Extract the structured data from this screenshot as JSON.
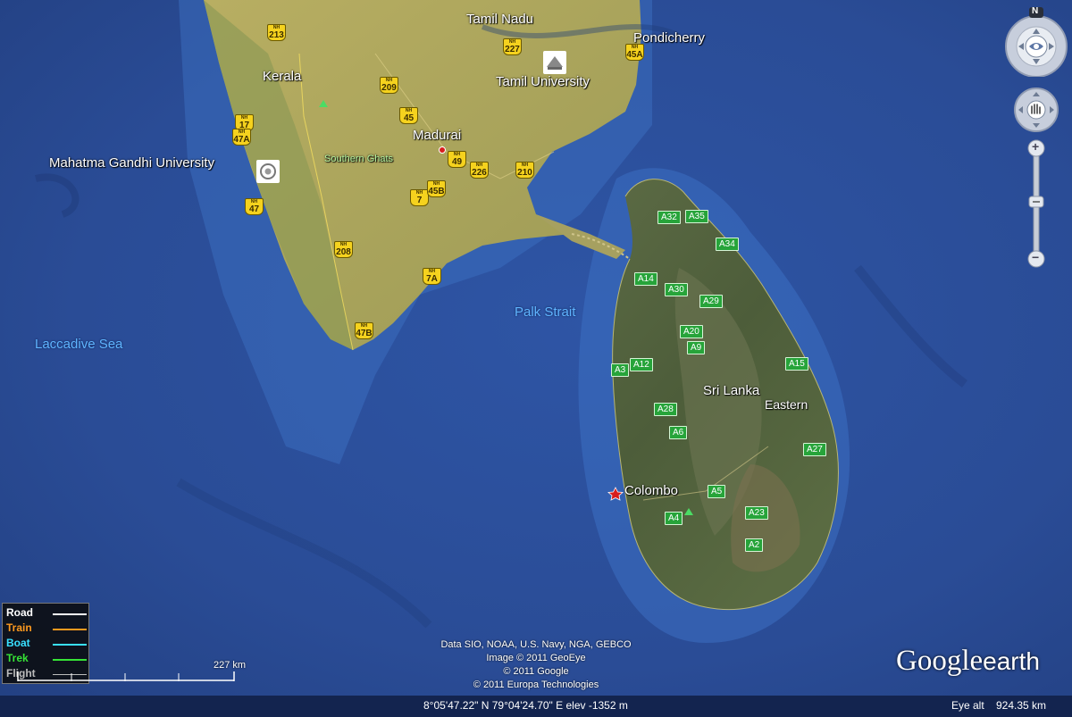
{
  "map": {
    "place_labels": {
      "tamil_nadu": "Tamil Nadu",
      "pondicherry": "Pondicherry",
      "kerala": "Kerala",
      "tamil_university": "Tamil University",
      "madurai": "Madurai",
      "southern_ghats": "Southern Ghats",
      "mahatma_gandhi_university": "Mahatma Gandhi University",
      "laccadive_sea": "Laccadive Sea",
      "palk_strait": "Palk Strait",
      "sri_lanka": "Sri Lanka",
      "eastern": "Eastern",
      "colombo": "Colombo"
    },
    "nh_shields": [
      "213",
      "209",
      "227",
      "45A",
      "17",
      "47A",
      "45",
      "49",
      "226",
      "210",
      "7",
      "45B",
      "47",
      "208",
      "7A",
      "47B"
    ],
    "sl_routes": [
      "A32",
      "A35",
      "A34",
      "A14",
      "A30",
      "A29",
      "A20",
      "A9",
      "A3",
      "A12",
      "A15",
      "A28",
      "A6",
      "A27",
      "A5",
      "A23",
      "A4",
      "A2"
    ]
  },
  "legend": {
    "road": "Road",
    "train": "Train",
    "boat": "Boat",
    "trek": "Trek",
    "flight": "Flight",
    "colors": {
      "road": "#ffffff",
      "train": "#ff9a1e",
      "boat": "#39e0ff",
      "trek": "#36e436",
      "flight": "#bbbbbb"
    }
  },
  "scale": {
    "label": "227 km"
  },
  "credits": {
    "line1": "Data SIO, NOAA, U.S. Navy, NGA, GEBCO",
    "line2": "Image © 2011 GeoEye",
    "line3": "© 2011 Google",
    "line4": "© 2011 Europa Technologies"
  },
  "logo": {
    "google": "Google",
    "earth": "earth"
  },
  "status": {
    "coords": "8°05'47.22\" N   79°04'24.70\" E  elev -1352 m",
    "eye_alt_label": "Eye alt",
    "eye_alt_value": "924.35 km"
  },
  "controls": {
    "north": "N",
    "zoom_in": "+",
    "zoom_out": "−"
  }
}
